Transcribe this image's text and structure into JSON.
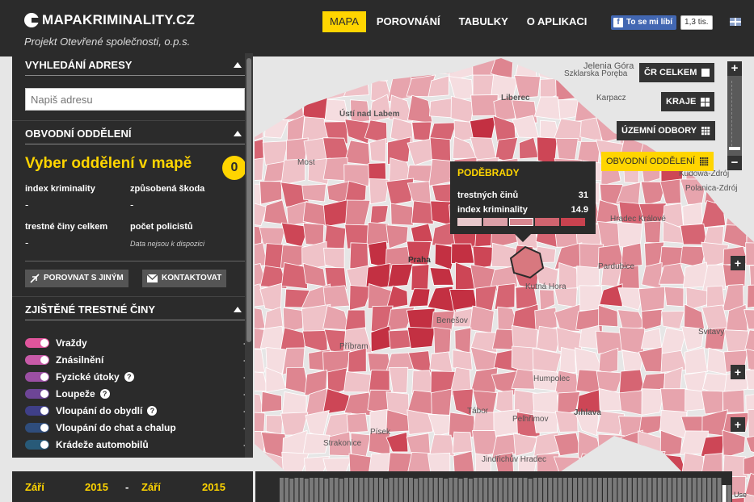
{
  "header": {
    "logo_text": "MAPAKRIMINALITY.CZ",
    "subtitle": "Projekt Otevřené společnosti, o.p.s.",
    "nav": [
      {
        "label": "MAPA",
        "active": true
      },
      {
        "label": "POROVNÁNÍ",
        "active": false
      },
      {
        "label": "TABULKY",
        "active": false
      },
      {
        "label": "O APLIKACI",
        "active": false
      }
    ],
    "fb_like_label": "To se mi líbí",
    "fb_count": "1,3 tis.",
    "language_icon": "uk-flag-icon"
  },
  "search": {
    "heading": "VYHLEDÁNÍ ADRESY",
    "placeholder": "Napiš adresu"
  },
  "district": {
    "heading": "OBVODNÍ ODDĚLENÍ",
    "prompt": "Vyber oddělení v mapě",
    "selected_count": "0",
    "stats": [
      {
        "label": "index kriminality",
        "value": "-"
      },
      {
        "label": "způsobená škoda",
        "value": "-"
      },
      {
        "label": "trestné činy celkem",
        "value": "-"
      },
      {
        "label": "počet policistů",
        "value": "Data nejsou k dispozici"
      }
    ],
    "compare_button": "POROVNAT S JINÝM",
    "contact_button": "KONTAKTOVAT"
  },
  "crimes": {
    "heading": "ZJIŠTĚNÉ TRESTNÉ ČINY",
    "items": [
      {
        "label": "Vraždy",
        "value": "-",
        "color": "#e0559c",
        "help": false
      },
      {
        "label": "Znásilnění",
        "value": "-",
        "color": "#c85aa8",
        "help": false
      },
      {
        "label": "Fyzické útoky",
        "value": "-",
        "color": "#9b4fa3",
        "help": true
      },
      {
        "label": "Loupeže",
        "value": "-",
        "color": "#6d4596",
        "help": true
      },
      {
        "label": "Vloupání do obydlí",
        "value": "-",
        "color": "#3f3f88",
        "help": true
      },
      {
        "label": "Vloupání do chat a chalup",
        "value": "-",
        "color": "#2f4d7c",
        "help": false
      },
      {
        "label": "Krádeže automobilů",
        "value": "-",
        "color": "#285a78",
        "help": false
      }
    ]
  },
  "time_range": {
    "from_month": "Září",
    "from_year": "2015",
    "separator": "-",
    "to_month": "Září",
    "to_year": "2015"
  },
  "layers": [
    {
      "label": "ČR CELKEM",
      "icon": "square-icon",
      "active": false
    },
    {
      "label": "KRAJE",
      "icon": "grid-2x2-icon",
      "active": false
    },
    {
      "label": "ÚZEMNÍ ODBORY",
      "icon": "grid-3x3-icon",
      "active": false
    },
    {
      "label": "OBVODNÍ ODDĚLENÍ",
      "icon": "grid-4x4-icon",
      "active": true
    }
  ],
  "zoom": {
    "in": "+",
    "out": "−"
  },
  "tooltip": {
    "title": "PODĚBRADY",
    "rows": [
      {
        "label": "trestných činů",
        "value": "31"
      },
      {
        "label": "index kriminality",
        "value": "14.9"
      }
    ],
    "scale_colors": [
      "#e8c8cc",
      "#dba0a8",
      "#d88790",
      "#d0646f",
      "#c9424f"
    ],
    "scale_selected_index": 2
  },
  "map_labels": [
    "Jelenia Góra",
    "Szklarska Poręba",
    "Karpacz",
    "Liberec",
    "Ústí nad Labem",
    "Most",
    "Praha",
    "Kutná Hora",
    "Pardubice",
    "Hradec Králové",
    "Příbram",
    "Benešov",
    "Tábor",
    "Jihlava",
    "Humpolec",
    "Pelhřimov",
    "Písek",
    "Strakonice",
    "Jindřichův Hradec",
    "Polanica-Zdrój",
    "Svitavy",
    "Kudowa-Zdrój",
    "Use"
  ],
  "colors": {
    "accent": "#ffd500",
    "panel": "#2b2b2b",
    "map_low": "#f2d4d8",
    "map_high": "#d8384a"
  },
  "histogram": [
    30,
    30,
    29,
    30,
    30,
    29,
    30,
    30,
    30,
    29,
    30,
    30,
    29,
    30,
    30,
    30,
    30,
    30,
    30,
    30,
    30,
    29,
    30,
    30,
    30,
    30,
    30,
    29,
    30,
    30,
    30,
    30,
    30,
    29,
    30,
    30,
    29,
    30,
    29,
    30,
    30,
    30,
    30,
    30,
    30,
    30,
    30,
    30,
    30,
    30,
    29,
    30,
    30,
    30,
    30,
    30,
    30,
    30,
    30,
    30,
    30,
    30,
    30,
    30,
    30,
    30,
    30,
    30,
    30,
    30,
    30,
    30,
    30,
    30,
    30,
    30,
    30,
    30,
    30,
    30,
    30,
    30,
    30,
    30,
    30,
    30,
    30,
    30,
    30,
    21,
    21
  ]
}
